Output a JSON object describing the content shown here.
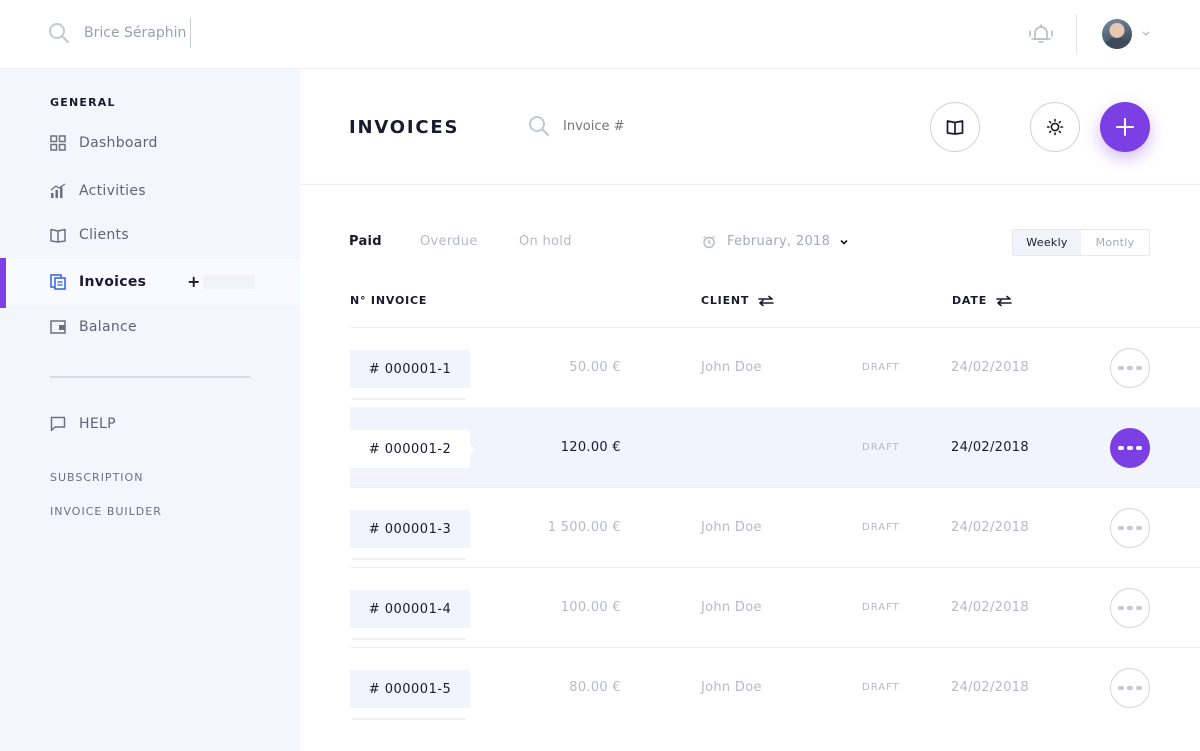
{
  "topbar": {
    "search_value": "Brice Séraphin",
    "icons": [
      "search-icon",
      "bell-icon",
      "chevron-down-icon"
    ]
  },
  "sidebar": {
    "section_label": "GENERAL",
    "items": [
      {
        "label": "Dashboard",
        "icon": "grid-icon"
      },
      {
        "label": "Activities",
        "icon": "bar-chart-icon"
      },
      {
        "label": "Clients",
        "icon": "book-icon"
      },
      {
        "label": "Invoices",
        "icon": "invoice-icon",
        "active": true
      },
      {
        "label": "Balance",
        "icon": "wallet-icon"
      }
    ],
    "invoices_plus": "+",
    "help_label": "HELP",
    "subscription_label": "SUBSCRIPTION",
    "invoice_builder_label": "INVOICE BUILDER"
  },
  "main": {
    "title": "INVOICES",
    "search_placeholder": "Invoice #",
    "tabs": [
      {
        "label": "Paid",
        "active": true
      },
      {
        "label": "Overdue"
      },
      {
        "label": "On hold"
      }
    ],
    "date_filter": "February, 2018",
    "period_toggle": {
      "options": [
        "Weekly",
        "Montly"
      ],
      "selected": "Weekly"
    },
    "columns": {
      "invoice": "N° INVOICE",
      "client": "CLIENT",
      "date": "DATE"
    },
    "rows": [
      {
        "number": "# 000001-1",
        "amount": "50.00 €",
        "client": "John Doe",
        "status": "DRAFT",
        "date": "24/02/2018"
      },
      {
        "number": "# 000001-2",
        "amount": "120.00 €",
        "client": "",
        "status": "DRAFT",
        "date": "24/02/2018",
        "selected": true
      },
      {
        "number": "# 000001-3",
        "amount": "1 500.00 €",
        "client": "John Doe",
        "status": "DRAFT",
        "date": "24/02/2018"
      },
      {
        "number": "# 000001-4",
        "amount": "100.00 €",
        "client": "John Doe",
        "status": "DRAFT",
        "date": "24/02/2018"
      },
      {
        "number": "# 000001-5",
        "amount": "80.00 €",
        "client": "John Doe",
        "status": "DRAFT",
        "date": "24/02/2018"
      }
    ]
  },
  "colors": {
    "accent": "#7b3fe4",
    "sidebar_bg": "#f4f6fd",
    "muted_text": "#b6bac4"
  }
}
